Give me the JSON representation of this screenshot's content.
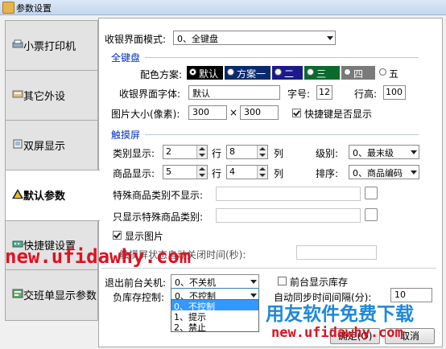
{
  "window": {
    "title": "参数设置"
  },
  "sidebar": {
    "tabs": [
      {
        "label": "小票打印机",
        "icon": "printer-icon"
      },
      {
        "label": "其它外设",
        "icon": "device-icon"
      },
      {
        "label": "双屏显示",
        "icon": "dual-screen-icon"
      },
      {
        "label": "默认参数",
        "icon": "warning-icon",
        "active": true
      },
      {
        "label": "快捷键设置",
        "icon": "keyboard-icon"
      },
      {
        "label": "交班单显示参数",
        "icon": "report-icon"
      }
    ]
  },
  "main": {
    "mode_label": "收银界面模式:",
    "mode_value": "0、全键盘",
    "keyboard_group": {
      "title": "全键盘",
      "scheme_label": "配色方案:",
      "schemes": [
        {
          "label": "默认",
          "color": "#000000",
          "selected": true
        },
        {
          "label": "方案一",
          "color": "#0a2a6e"
        },
        {
          "label": "二",
          "color": "#1a1a8c"
        },
        {
          "label": "三",
          "color": "#0b6b2e"
        },
        {
          "label": "四",
          "color": "#7a7a7a"
        },
        {
          "label": "五",
          "color": "#ffffff"
        }
      ],
      "font_label": "收银界面字体:",
      "font_value": "默认",
      "size_label": "字号:",
      "size_value": "12",
      "line_height_label": "行高:",
      "line_height_value": "100",
      "image_size_label": "图片大小(像素):",
      "image_width": "300",
      "times": "×",
      "image_height": "300",
      "shortcut_hidden_label": "快捷键是否显示",
      "shortcut_hidden_checked": true
    },
    "touch_group": {
      "title": "触摸屏",
      "category_label": "类别显示:",
      "category_rows": "2",
      "row_unit": "行",
      "category_cols": "8",
      "col_unit": "列",
      "level_label": "级别:",
      "level_value": "0、最末级",
      "product_label": "商品显示:",
      "product_rows": "5",
      "product_cols": "4",
      "sort_label": "排序:",
      "sort_value": "0、商品编码",
      "hide_special_label": "特殊商品类别不显示:",
      "only_special_label": "只显示特殊商品类别:",
      "show_image_label": "显示图片",
      "show_image_checked": true,
      "auto_lock_label": "触摸屏状态自动关闭时间(秒):",
      "auto_lock_value": ""
    },
    "exit_label": "退出前台关机:",
    "exit_value": "0、不关机",
    "show_stock_label": "前台显示库存",
    "show_stock_checked": false,
    "negative_stock_label": "负库存控制:",
    "negative_stock_value": "0、不控制",
    "negative_stock_options": [
      "0、不控制",
      "1、提示",
      "2、禁止"
    ],
    "sync_interval_label": "自动同步时间间隔(分):",
    "sync_interval_value": "10",
    "ok_button": "确定(O)",
    "cancel_button": "取消"
  },
  "watermark": {
    "url1": "new.ufidawhy.com",
    "brand": "用友软件免费下载",
    "url2": "new.ufidawhy.com"
  }
}
